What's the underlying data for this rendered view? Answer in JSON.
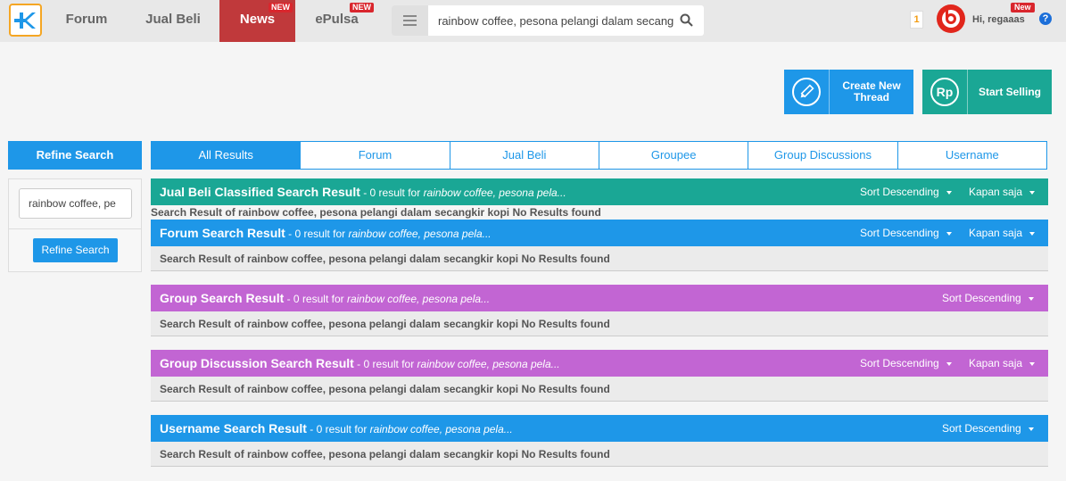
{
  "topbar": {
    "nav": [
      {
        "label": "Forum",
        "active": false,
        "badge": ""
      },
      {
        "label": "Jual Beli",
        "active": false,
        "badge": ""
      },
      {
        "label": "News",
        "active": true,
        "badge": "NEW"
      },
      {
        "label": "ePulsa",
        "active": false,
        "badge": "NEW"
      }
    ],
    "search_value": "rainbow coffee, pesona pelangi dalam secang",
    "notification_count": "1",
    "greeting": "Hi, regaaas",
    "user_badge": "New"
  },
  "actions": {
    "create_thread": "Create New Thread",
    "start_selling": "Start Selling",
    "rp_symbol": "Rp"
  },
  "refine": {
    "header": "Refine Search",
    "input_value": "rainbow coffee, pe",
    "button": "Refine Search"
  },
  "tabs": [
    "All Results",
    "Forum",
    "Jual Beli",
    "Groupee",
    "Group Discussions",
    "Username"
  ],
  "sections": [
    {
      "title": "Jual Beli Classified Search Result",
      "meta": " - 0 result for ",
      "query": "rainbow coffee, pesona pela...",
      "sort": "Sort Descending",
      "time": "Kapan saja",
      "body": "Search Result of rainbow coffee, pesona pelangi dalam secangkir kopi No Results found"
    },
    {
      "title": "Forum Search Result",
      "meta": " - 0 result for ",
      "query": "rainbow coffee, pesona pela...",
      "sort": "Sort Descending",
      "time": "Kapan saja",
      "body": "Search Result of rainbow coffee, pesona pelangi dalam secangkir kopi No Results found"
    },
    {
      "title": "Group Search Result",
      "meta": " - 0 result for ",
      "query": "rainbow coffee, pesona pela...",
      "sort": "Sort Descending",
      "body": "Search Result of rainbow coffee, pesona pelangi dalam secangkir kopi No Results found"
    },
    {
      "title": "Group Discussion Search Result",
      "meta": " - 0 result for ",
      "query": "rainbow coffee, pesona pela...",
      "sort": "Sort Descending",
      "time": "Kapan saja",
      "body": "Search Result of rainbow coffee, pesona pelangi dalam secangkir kopi No Results found"
    },
    {
      "title": "Username Search Result",
      "meta": " - 0 result for ",
      "query": "rainbow coffee, pesona pela...",
      "sort": "Sort Descending",
      "body": "Search Result of rainbow coffee, pesona pelangi dalam secangkir kopi No Results found"
    }
  ],
  "colors": {
    "teal": "#1aa795",
    "blue": "#1e97e8",
    "purple": "#c265d3",
    "news_red": "#c0393b"
  }
}
